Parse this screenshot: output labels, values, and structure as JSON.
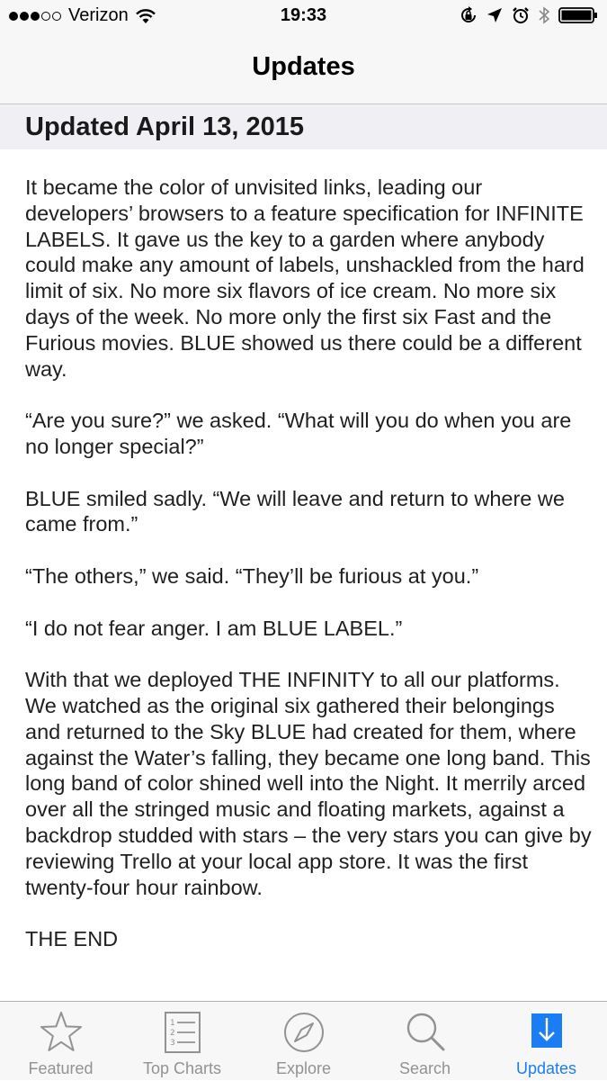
{
  "status": {
    "carrier": "Verizon",
    "time": "19:33",
    "signal_bars_filled": 3,
    "signal_bars_total": 5
  },
  "nav": {
    "title": "Updates"
  },
  "section": {
    "title": "Updated April 13, 2015"
  },
  "paragraphs": [
    "It became the color of unvisited links, leading our developers’ browsers to a feature specification for INFINITE LABELS. It gave us the key to a garden where anybody could make any amount of labels, unshackled from the hard limit of six. No more six flavors of ice cream. No more six days of the week. No more only the first six Fast and the Furious movies. BLUE showed us there could be a different way.",
    "“Are you sure?” we asked. “What will you do when you are no longer special?”",
    "BLUE smiled sadly. “We will leave and return to where we came from.”",
    "“The others,” we said. “They’ll be furious at you.”",
    "“I do not fear anger. I am BLUE LABEL.”",
    "With that we deployed THE INFINITY to all our platforms. We watched as the original six gathered their belongings and returned to the Sky BLUE had created for them, where against the Water’s falling, they became one long band. This long band of color shined well into the Night. It merrily arced over all the stringed music and floating markets, against a backdrop studded with stars – the very stars you can give by reviewing Trello at your local app store. It was the first twenty-four hour rainbow.",
    "THE END"
  ],
  "tabs": [
    {
      "label": "Featured",
      "icon": "star-icon"
    },
    {
      "label": "Top Charts",
      "icon": "list-icon"
    },
    {
      "label": "Explore",
      "icon": "compass-icon"
    },
    {
      "label": "Search",
      "icon": "search-icon"
    },
    {
      "label": "Updates",
      "icon": "download-icon",
      "active": true
    }
  ],
  "colors": {
    "accent": "#1a7df5",
    "inactive": "#929292",
    "bar_background": "#f7f7f7",
    "section_background": "#efeff4"
  }
}
